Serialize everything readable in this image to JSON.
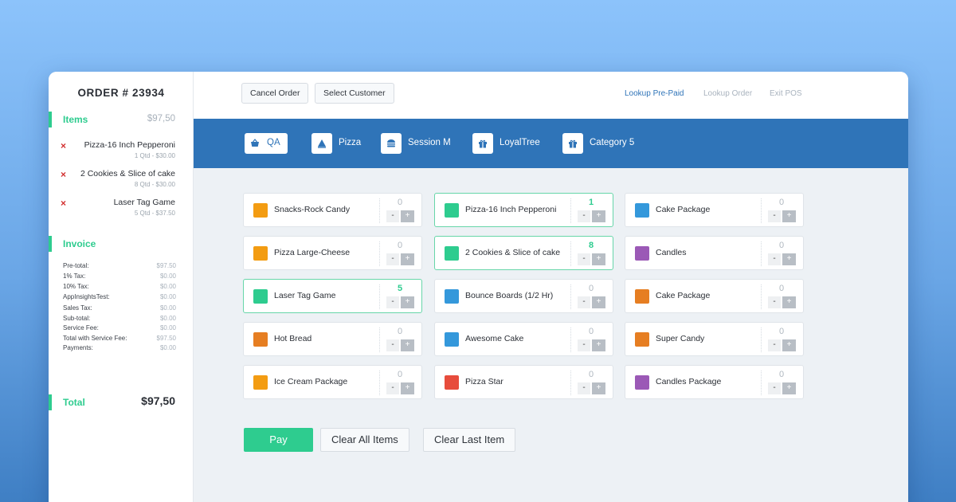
{
  "order": {
    "title": "ORDER # 23934",
    "items_label": "Items",
    "items_total": "$97,50",
    "items": [
      {
        "name": "Pizza-16 Inch Pepperoni",
        "qty": "1 Qtd - $30.00",
        "remove": "×"
      },
      {
        "name": "2 Cookies & Slice of cake",
        "qty": "8  Qtd - $30.00",
        "remove": "×"
      },
      {
        "name": "Laser Tag Game",
        "qty": "5 Qtd - $37.50",
        "remove": "×"
      }
    ],
    "invoice_label": "Invoice",
    "invoice": [
      {
        "key": "Pre-total:",
        "value": "$97.50"
      },
      {
        "key": "1% Tax:",
        "value": "$0.00"
      },
      {
        "key": "10% Tax:",
        "value": "$0.00"
      },
      {
        "key": "AppInsightsTest:",
        "value": "$0.00"
      },
      {
        "key": "Sales Tax:",
        "value": "$0.00"
      },
      {
        "key": "Sub-total:",
        "value": "$0.00"
      },
      {
        "key": "Service Fee:",
        "value": "$0.00"
      },
      {
        "key": "Total with Service Fee:",
        "value": "$97.50"
      },
      {
        "key": "Payments:",
        "value": "$0.00"
      }
    ],
    "total_label": "Total",
    "total_value": "$97,50"
  },
  "topbar": {
    "cancel_order": "Cancel Order",
    "select_customer": "Select Customer",
    "lookup_prepaid": "Lookup Pre-Paid",
    "lookup_order": "Lookup Order",
    "exit_pos": "Exit POS",
    "link_color": "#2f74b8",
    "muted_color": "#a9b3be"
  },
  "categories": [
    {
      "label": "QA",
      "icon": "basket-icon",
      "glyph": "🧺",
      "active": true
    },
    {
      "label": "Pizza",
      "icon": "pizza-icon",
      "glyph": "◭"
    },
    {
      "label": "Session M",
      "icon": "burger-icon",
      "glyph": "◓"
    },
    {
      "label": "LoyalTree",
      "icon": "gift-icon",
      "glyph": "▣"
    },
    {
      "label": "Category 5",
      "icon": "gift-icon",
      "glyph": "▣"
    }
  ],
  "products": [
    {
      "name": "Snacks-Rock Candy",
      "color": "#f39c12",
      "count": "0",
      "selected": false
    },
    {
      "name": "Pizza-16 Inch Pepperoni",
      "color": "#2ecc8f",
      "count": "1",
      "selected": true
    },
    {
      "name": "Cake Package",
      "color": "#3498db",
      "count": "0",
      "selected": false
    },
    {
      "name": "Pizza Large-Cheese",
      "color": "#f39c12",
      "count": "0",
      "selected": false
    },
    {
      "name": "2 Cookies & Slice of cake",
      "color": "#2ecc8f",
      "count": "8",
      "selected": true
    },
    {
      "name": "Candles",
      "color": "#9b59b6",
      "count": "0",
      "selected": false
    },
    {
      "name": "Laser Tag Game",
      "color": "#2ecc8f",
      "count": "5",
      "selected": true
    },
    {
      "name": "Bounce Boards (1/2 Hr)",
      "color": "#3498db",
      "count": "0",
      "selected": false
    },
    {
      "name": "Cake Package",
      "color": "#e67e22",
      "count": "0",
      "selected": false
    },
    {
      "name": "Hot Bread",
      "color": "#e67e22",
      "count": "0",
      "selected": false
    },
    {
      "name": "Awesome Cake",
      "color": "#3498db",
      "count": "0",
      "selected": false
    },
    {
      "name": "Super Candy",
      "color": "#e67e22",
      "count": "0",
      "selected": false
    },
    {
      "name": "Ice Cream Package",
      "color": "#f39c12",
      "count": "0",
      "selected": false
    },
    {
      "name": "Pizza Star",
      "color": "#e74c3c",
      "count": "0",
      "selected": false
    },
    {
      "name": "Candles Package",
      "color": "#9b59b6",
      "count": "0",
      "selected": false
    }
  ],
  "stepper": {
    "minus": "-",
    "plus": "+"
  },
  "actions": {
    "pay": "Pay",
    "clear_all": "Clear All Items",
    "clear_last": "Clear Last Item"
  }
}
